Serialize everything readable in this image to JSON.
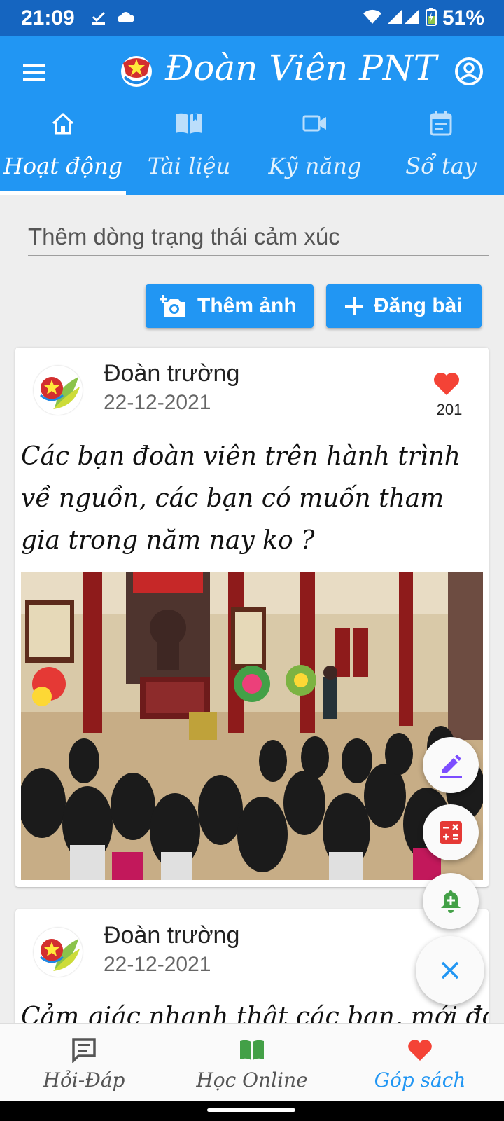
{
  "status_bar": {
    "time": "21:09",
    "battery": "51%"
  },
  "app": {
    "title": "Đoàn Viên PNT"
  },
  "tabs": [
    {
      "label": "Hoạt động",
      "icon": "home-icon",
      "active": true
    },
    {
      "label": "Tài liệu",
      "icon": "book-icon",
      "active": false
    },
    {
      "label": "Kỹ năng",
      "icon": "video-icon",
      "active": false
    },
    {
      "label": "Sổ tay",
      "icon": "notebook-icon",
      "active": false
    }
  ],
  "composer": {
    "placeholder": "Thêm dòng trạng thái cảm xúc",
    "add_photo_label": "Thêm ảnh",
    "post_label": "Đăng bài"
  },
  "posts": [
    {
      "author": "Đoàn trường",
      "date": "22-12-2021",
      "likes": "201",
      "text": "Các bạn đoàn viên trên hành trình về nguồn, các bạn có muốn tham gia trong năm nay ko ?"
    },
    {
      "author": "Đoàn trường",
      "date": "22-12-2021",
      "text": "Cảm giác nhanh thật các bạn, mới đó mà"
    }
  ],
  "bottom_nav": [
    {
      "label": "Hỏi-Đáp",
      "icon": "chat-icon",
      "active": false
    },
    {
      "label": "Học Online",
      "icon": "open-book-icon",
      "active": false
    },
    {
      "label": "Góp sách",
      "icon": "heart-icon",
      "active": true
    }
  ],
  "colors": {
    "primary": "#2196f3",
    "status_bar": "#1565c0",
    "like_red": "#f44336",
    "fab_purple": "#7c4dff",
    "fab_red": "#e53935",
    "fab_green": "#43a047"
  }
}
